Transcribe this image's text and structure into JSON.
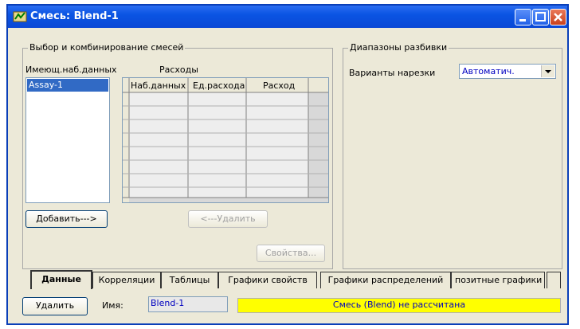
{
  "window": {
    "title": "Смесь: Blend-1"
  },
  "blend_group": {
    "title": "Выбор и комбинирование смесей",
    "available_label": "Имеющ.наб.данных",
    "consumption_label": "Расходы",
    "available_items": [
      "Assay-1"
    ],
    "table": {
      "columns": [
        "Наб.данных",
        "Ед.расхода",
        "Расход"
      ],
      "empty_rows": 8
    },
    "add_button": "Добавить--->",
    "remove_button": "<---Удалить",
    "properties_button": "Свойства..."
  },
  "ranges_group": {
    "title": "Диапазоны разбивки",
    "cut_label": "Варианты нарезки",
    "cut_value": "Автоматич."
  },
  "tabs": [
    "Данные",
    "Корреляции",
    "Таблицы",
    "Графики свойств",
    "Графики распределений",
    "позитные графики"
  ],
  "footer": {
    "delete_button": "Удалить",
    "name_label": "Имя:",
    "name_value": "Blend-1",
    "status_text": "Смесь (Blend) не рассчитана"
  },
  "colors": {
    "title_bar": "#0a54e3",
    "status_bg": "#ffff00",
    "selection": "#316ac5"
  }
}
